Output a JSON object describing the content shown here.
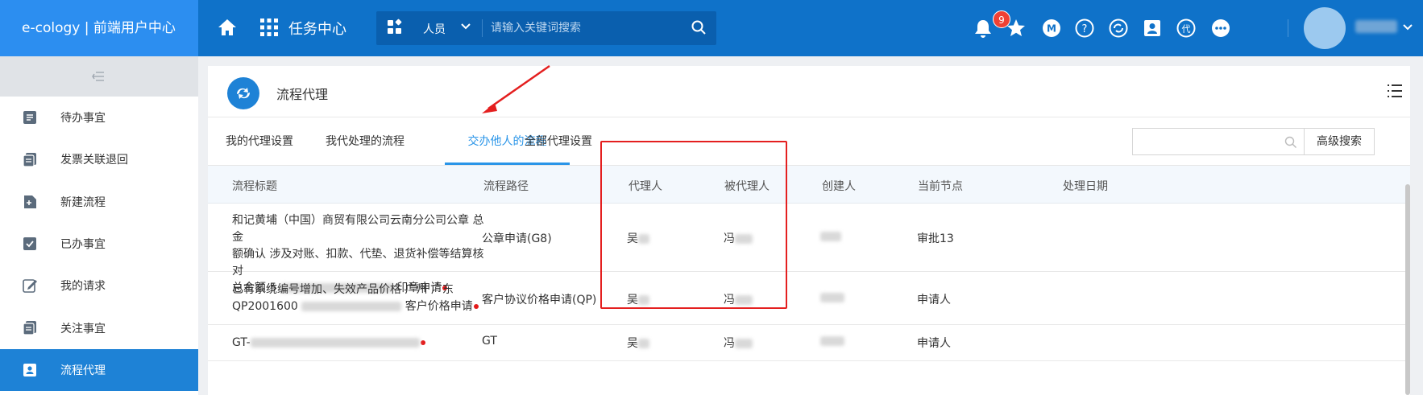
{
  "topbar": {
    "brand": "e-cology | 前端用户中心",
    "module": "任务中心",
    "search_scope": "人员",
    "search_placeholder": "请输入关键词搜索",
    "notification_count": "9"
  },
  "sidebar": {
    "items": [
      {
        "label": "待办事宜",
        "icon": "todo-icon"
      },
      {
        "label": "发票关联退回",
        "icon": "invoice-icon"
      },
      {
        "label": "新建流程",
        "icon": "new-flow-icon"
      },
      {
        "label": "已办事宜",
        "icon": "done-icon"
      },
      {
        "label": "我的请求",
        "icon": "edit-icon"
      },
      {
        "label": "关注事宜",
        "icon": "follow-icon"
      },
      {
        "label": "流程代理",
        "icon": "agent-icon",
        "active": true
      }
    ]
  },
  "page": {
    "title": "流程代理",
    "tabs": [
      "我的代理设置",
      "我代处理的流程",
      "交办他人的流程",
      "全部代理设置"
    ],
    "active_tab": "交办他人的流程",
    "advanced_search": "高级搜索"
  },
  "table": {
    "columns": [
      "流程标题",
      "流程路径",
      "代理人",
      "被代理人",
      "创建人",
      "当前节点",
      "处理日期"
    ],
    "rows": [
      {
        "title_line1": "和记黄埔（中国）商贸有限公司云南分公司公章 总金",
        "title_line2": "额确认 涉及对账、扣款、代垫、退货补偿等结算核对",
        "title_line3_prefix": "总金额 5",
        "title_line3_suffix": "印章申请",
        "path": "公章申请(G8)",
        "agent": "吴",
        "principal": "冯",
        "creator": "",
        "node": "审批13",
        "date": ""
      },
      {
        "title_line1": "已有系统编号增加、失效产品价格 广州 广东",
        "title_line2_prefix": "QP2001600",
        "title_line2_suffix": "客户价格申请",
        "path": "客户协议价格申请(QP)",
        "agent": "吴",
        "principal": "冯",
        "creator": "",
        "node": "申请人",
        "date": ""
      },
      {
        "title_prefix": "GT-",
        "path": "GT",
        "agent": "吴",
        "principal": "冯",
        "creator": "",
        "node": "申请人",
        "date": ""
      }
    ]
  },
  "colors": {
    "topbar": "#0f72c9",
    "brand": "#2c8ef0",
    "active_tab": "#2a95e8",
    "highlight_box": "#e41f1f"
  }
}
